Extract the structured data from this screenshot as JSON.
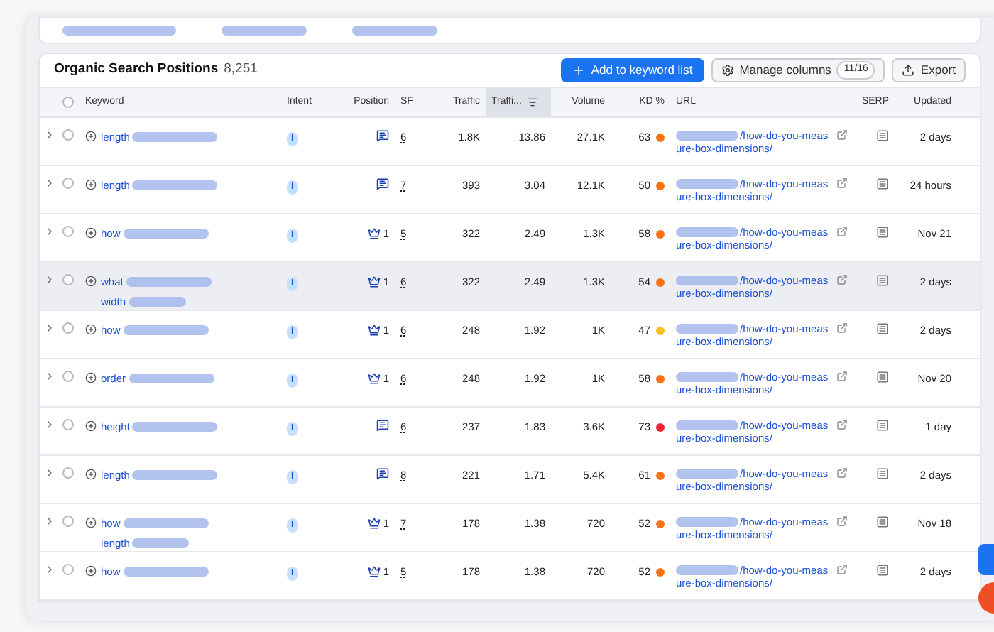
{
  "panel": {
    "title": "Organic Search Positions",
    "count": "8,251"
  },
  "actions": [
    {
      "kind": "primary",
      "label": "Add to keyword list"
    },
    {
      "kind": "columns",
      "label": "Manage columns",
      "badge": "11/16"
    },
    {
      "kind": "export",
      "label": "Export"
    }
  ],
  "select_all": {
    "checked": false
  },
  "columns": [
    {
      "label": "Keyword",
      "sorted": false
    },
    {
      "label": "Intent",
      "sorted": false
    },
    {
      "label": "Position",
      "sorted": false
    },
    {
      "label": "SF",
      "sorted": false
    },
    {
      "label": "Traffic",
      "sorted": false
    },
    {
      "label": "Traffi...",
      "sorted": true
    },
    {
      "label": "Volume",
      "sorted": false
    },
    {
      "label": "KD %",
      "sorted": false
    },
    {
      "label": "URL",
      "sorted": false
    },
    {
      "label": "SERP",
      "sorted": false
    },
    {
      "label": "Updated",
      "sorted": false
    }
  ],
  "rows": [
    {
      "checked": false,
      "keyword": [
        "length"
      ],
      "intent": "I",
      "position": {
        "kind": "feature"
      },
      "sf": "6",
      "traffic": "1.8K",
      "traffic_pct": "13.86",
      "volume": "27.1K",
      "kd": "63",
      "color": "#f97316",
      "url": "/how-do-you-measure-box-dimensions/",
      "updated": "2 days",
      "highlighted": false
    },
    {
      "checked": false,
      "keyword": [
        "length"
      ],
      "intent": "I",
      "position": {
        "kind": "feature"
      },
      "sf": "7",
      "traffic": "393",
      "traffic_pct": "3.04",
      "volume": "12.1K",
      "kd": "50",
      "color": "#f97316",
      "url": "/how-do-you-measure-box-dimensions/",
      "updated": "24 hours",
      "highlighted": false
    },
    {
      "checked": false,
      "keyword": [
        "how"
      ],
      "intent": "I",
      "position": {
        "kind": "rank",
        "text": "1"
      },
      "sf": "5",
      "traffic": "322",
      "traffic_pct": "2.49",
      "volume": "1.3K",
      "kd": "58",
      "color": "#f97316",
      "url": "/how-do-you-measure-box-dimensions/",
      "updated": "Nov 21",
      "highlighted": false
    },
    {
      "checked": false,
      "keyword": [
        "what",
        "width"
      ],
      "intent": "I",
      "position": {
        "kind": "rank",
        "text": "1"
      },
      "sf": "6",
      "traffic": "322",
      "traffic_pct": "2.49",
      "volume": "1.3K",
      "kd": "54",
      "color": "#f97316",
      "url": "/how-do-you-measure-box-dimensions/",
      "updated": "2 days",
      "highlighted": true
    },
    {
      "checked": false,
      "keyword": [
        "how"
      ],
      "intent": "I",
      "position": {
        "kind": "rank",
        "text": "1"
      },
      "sf": "6",
      "traffic": "248",
      "traffic_pct": "1.92",
      "volume": "1K",
      "kd": "47",
      "color": "#fbbf24",
      "url": "/how-do-you-measure-box-dimensions/",
      "updated": "2 days",
      "highlighted": false
    },
    {
      "checked": false,
      "keyword": [
        "order"
      ],
      "intent": "I",
      "position": {
        "kind": "rank",
        "text": "1"
      },
      "sf": "6",
      "traffic": "248",
      "traffic_pct": "1.92",
      "volume": "1K",
      "kd": "58",
      "color": "#f97316",
      "url": "/how-do-you-measure-box-dimensions/",
      "updated": "Nov 20",
      "highlighted": false
    },
    {
      "checked": false,
      "keyword": [
        "height"
      ],
      "intent": "I",
      "position": {
        "kind": "feature"
      },
      "sf": "6",
      "traffic": "237",
      "traffic_pct": "1.83",
      "volume": "3.6K",
      "kd": "73",
      "color": "#ef233c",
      "url": "/how-do-you-measure-box-dimensions/",
      "updated": "1 day",
      "highlighted": false
    },
    {
      "checked": false,
      "keyword": [
        "length"
      ],
      "intent": "I",
      "position": {
        "kind": "feature"
      },
      "sf": "8",
      "traffic": "221",
      "traffic_pct": "1.71",
      "volume": "5.4K",
      "kd": "61",
      "color": "#f97316",
      "url": "/how-do-you-measure-box-dimensions/",
      "updated": "2 days",
      "highlighted": false
    },
    {
      "checked": false,
      "keyword": [
        "how",
        "length"
      ],
      "intent": "I",
      "position": {
        "kind": "rank",
        "text": "1"
      },
      "sf": "7",
      "traffic": "178",
      "traffic_pct": "1.38",
      "volume": "720",
      "kd": "52",
      "color": "#f97316",
      "url": "/how-do-you-measure-box-dimensions/",
      "updated": "Nov 18",
      "highlighted": false
    },
    {
      "checked": false,
      "keyword": [
        "how"
      ],
      "intent": "I",
      "position": {
        "kind": "rank",
        "text": "1"
      },
      "sf": "5",
      "traffic": "178",
      "traffic_pct": "1.38",
      "volume": "720",
      "kd": "52",
      "color": "#f97316",
      "url": "/how-do-you-measure-box-dimensions/",
      "updated": "2 days",
      "highlighted": false
    }
  ]
}
